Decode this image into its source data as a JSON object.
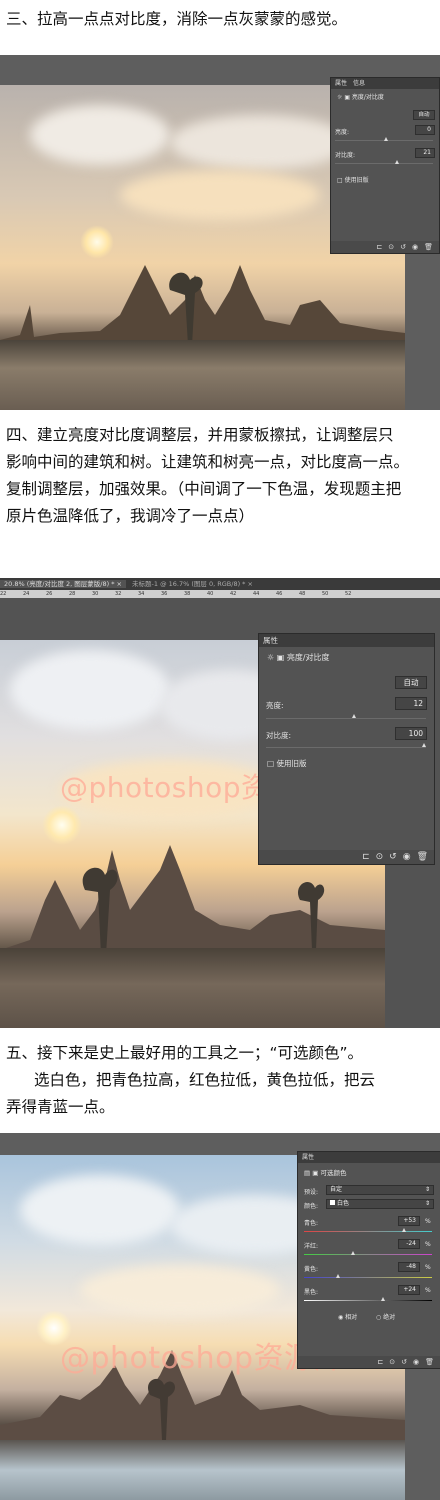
{
  "step3": {
    "text": "三、拉高一点点对比度，消除一点灰蒙蒙的感觉。",
    "panel": {
      "tabs": [
        "属性",
        "信息"
      ],
      "title": "亮度/对比度",
      "auto_label": "自动",
      "brightness_label": "亮度:",
      "brightness_value": "0",
      "contrast_label": "对比度:",
      "contrast_value": "21",
      "legacy_label": "使用旧版"
    }
  },
  "step4": {
    "text_lines": [
      "四、建立亮度对比度调整层，并用蒙板擦拭，让调整层只",
      "影响中间的建筑和树。让建筑和树亮一点，对比度高一点。",
      "复制调整层，加强效果。（中间调了一下色温，发现题主把",
      "原片色温降低了，我调冷了一点点）"
    ],
    "tab1": "20.8% (亮度/对比度 2, 图层蒙版/8) * ×",
    "tab2": "未标题-1 @ 16.7% (图层 0, RGB/8) * ×",
    "ruler_marks": [
      "22",
      "24",
      "26",
      "28",
      "30",
      "32",
      "34",
      "36",
      "38",
      "40",
      "42",
      "44",
      "46",
      "48",
      "50",
      "52"
    ],
    "watermark": "@photoshop资源库",
    "panel": {
      "tab": "属性",
      "title": "亮度/对比度",
      "auto_label": "自动",
      "brightness_label": "亮度:",
      "brightness_value": "12",
      "contrast_label": "对比度:",
      "contrast_value": "100",
      "legacy_label": "使用旧版"
    }
  },
  "step5": {
    "text_lines": [
      "五、接下来是史上最好用的工具之一；“可选颜色”。",
      "选白色，把青色拉高，红色拉低，黄色拉低，把云",
      "弄得青蓝一点。"
    ],
    "watermark": "@photoshop资源库",
    "panel": {
      "tab": "属性",
      "title": "可选颜色",
      "preset_label": "预设:",
      "preset_value": "自定",
      "colors_label": "颜色:",
      "colors_value": "白色",
      "cyan_label": "青色:",
      "cyan_value": "+53",
      "magenta_label": "洋红:",
      "magenta_value": "-24",
      "yellow_label": "黄色:",
      "yellow_value": "-48",
      "black_label": "黑色:",
      "black_value": "+24",
      "percent": "%",
      "relative_label": "相对",
      "absolute_label": "绝对"
    }
  }
}
